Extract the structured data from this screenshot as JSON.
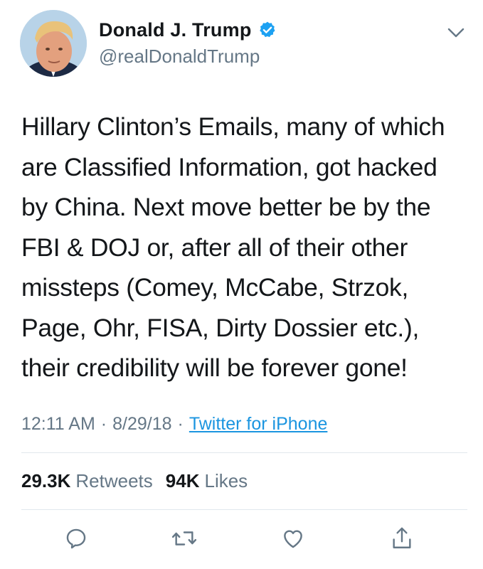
{
  "author": {
    "name": "Donald J. Trump",
    "handle": "@realDonaldTrump",
    "verified": true
  },
  "tweet": {
    "text": "Hillary Clinton’s Emails, many of which are Classified Information, got hacked by China. Next move better be by the FBI & DOJ or, after all of their other missteps (Comey, McCabe, Strzok, Page, Ohr, FISA, Dirty Dossier etc.), their credibility will be forever gone!",
    "time": "12:11 AM",
    "date": "8/29/18",
    "separator": "·",
    "source": "Twitter for iPhone"
  },
  "stats": {
    "retweets_count": "29.3K",
    "retweets_label": "Retweets",
    "likes_count": "94K",
    "likes_label": "Likes"
  },
  "icons": {
    "verified": "verified-badge-icon",
    "caret": "chevron-down-icon",
    "reply": "reply-icon",
    "retweet": "retweet-icon",
    "like": "heart-icon",
    "share": "share-icon"
  },
  "colors": {
    "text": "#14171a",
    "secondary": "#657786",
    "link": "#1b95e0",
    "verified": "#1da1f2",
    "divider": "#e1e8ed"
  }
}
